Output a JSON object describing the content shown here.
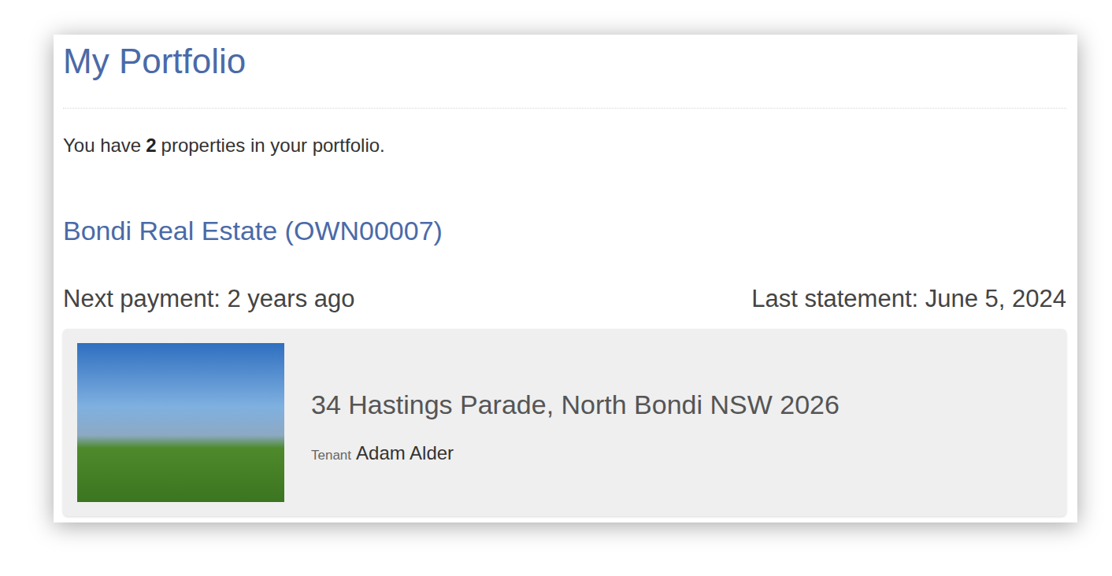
{
  "title": "My Portfolio",
  "summary": {
    "prefix": "You have",
    "count": "2",
    "suffix": "properties in your portfolio."
  },
  "owner": {
    "name": "Bondi Real Estate (OWN00007)",
    "next_payment": "Next payment: 2 years ago",
    "last_statement": "Last statement: June 5, 2024"
  },
  "properties": [
    {
      "address": "34 Hastings Parade, North Bondi NSW 2026",
      "tenant_label": "Tenant",
      "tenant": "Adam Alder"
    }
  ]
}
